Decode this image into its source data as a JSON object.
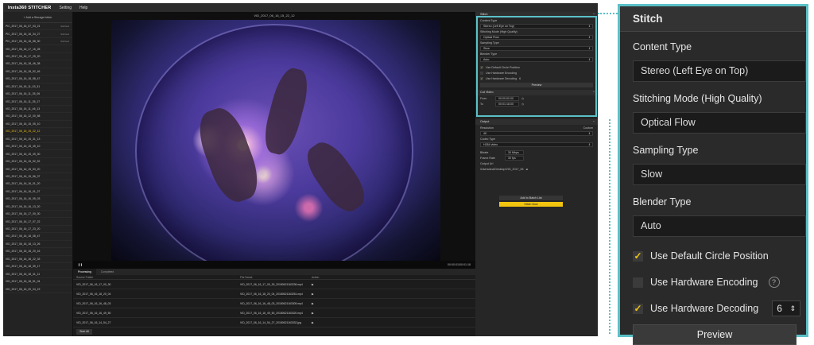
{
  "app": {
    "brand": "Insta360 STITCHER",
    "menus": [
      "Setting",
      "Help"
    ]
  },
  "sidebar": {
    "add_label": "+ Add a Storage folder",
    "files": [
      {
        "name": "PIC_2017_06_16_07_03_21",
        "status": "Stitched",
        "active": false
      },
      {
        "name": "PIC_2017_06_16_16_34_27",
        "status": "Stitched",
        "active": false
      },
      {
        "name": "PIC_2017_06_16_16_58_30",
        "status": "Stitched",
        "active": false
      },
      {
        "name": "VID_2017_06_16_17_16_28",
        "status": "",
        "active": false
      },
      {
        "name": "VID_2017_06_16_17_25_20",
        "status": "",
        "active": false
      },
      {
        "name": "VID_2017_06_16_18_46_38",
        "status": "",
        "active": false
      },
      {
        "name": "VID_2017_06_16_18_52_46",
        "status": "",
        "active": false
      },
      {
        "name": "VID_2017_06_16_18_58_47",
        "status": "",
        "active": false
      },
      {
        "name": "VID_2017_06_16_11_03_31",
        "status": "",
        "active": false
      },
      {
        "name": "VID_2017_06_16_11_35_06",
        "status": "",
        "active": false
      },
      {
        "name": "VID_2017_06_16_11_35_17",
        "status": "",
        "active": false
      },
      {
        "name": "VID_2017_06_16_11_46_13",
        "status": "",
        "active": false
      },
      {
        "name": "VID_2017_06_16_12_00_58",
        "status": "",
        "active": false
      },
      {
        "name": "VID_2017_06_16_15_05_10",
        "status": "",
        "active": false
      },
      {
        "name": "VID_2017_06_16_15_22_12",
        "status": "",
        "active": true
      },
      {
        "name": "VID_2017_06_16_15_31_13",
        "status": "",
        "active": false
      },
      {
        "name": "VID_2017_06_16_15_45_10",
        "status": "",
        "active": false
      },
      {
        "name": "VID_2017_06_16_15_49_30",
        "status": "",
        "active": false
      },
      {
        "name": "VID_2017_06_16_15_52_52",
        "status": "",
        "active": false
      },
      {
        "name": "VID_2017_06_16_15_53_20",
        "status": "",
        "active": false
      },
      {
        "name": "VID_2017_06_16_15_56_37",
        "status": "",
        "active": false
      },
      {
        "name": "VID_2017_06_16_16_01_20",
        "status": "",
        "active": false
      },
      {
        "name": "VID_2017_06_16_16_01_27",
        "status": "",
        "active": false
      },
      {
        "name": "VID_2017_06_16_16_05_03",
        "status": "",
        "active": false
      },
      {
        "name": "VID_2017_06_16_16_13_20",
        "status": "",
        "active": false
      },
      {
        "name": "VID_2017_06_16_17_00_30",
        "status": "",
        "active": false
      },
      {
        "name": "VID_2017_06_16_17_07_22",
        "status": "",
        "active": false
      },
      {
        "name": "VID_2017_06_16_17_23_20",
        "status": "",
        "active": false
      },
      {
        "name": "VID_2017_06_16_18_08_47",
        "status": "",
        "active": false
      },
      {
        "name": "VID_2017_06_16_18_13_26",
        "status": "",
        "active": false
      },
      {
        "name": "VID_2017_06_16_18_20_16",
        "status": "",
        "active": false
      },
      {
        "name": "VID_2017_06_16_18_22_33",
        "status": "",
        "active": false
      },
      {
        "name": "VID_2017_06_16_18_39_17",
        "status": "",
        "active": false
      },
      {
        "name": "VID_2017_06_16_18_41_11",
        "status": "",
        "active": false
      },
      {
        "name": "VID_2017_06_16_18_51_04",
        "status": "",
        "active": false
      },
      {
        "name": "VID_2017_06_16_20_04_19",
        "status": "",
        "active": false
      }
    ]
  },
  "viewer": {
    "title": "VID_2017_06_16_15_22_12",
    "time": "00:00:01/00:01:18"
  },
  "queue": {
    "tab_processing": "Processing",
    "tab_completed": "Completed",
    "col_source": "Source Folder",
    "col_file": "File Name",
    "col_action": "Action",
    "rows": [
      {
        "src": "VID_2017_06_16_17_00_30",
        "file": "VID_2017_06_16_17_00_30_20180621163236.mp4"
      },
      {
        "src": "VID_2017_06_16_18_20_04",
        "file": "VID_2017_06_16_18_20_04_20180621163251.mp4"
      },
      {
        "src": "VID_2017_06_16_16_48_03",
        "file": "VID_2017_06_16_16_48_03_20180621163305.mp4"
      },
      {
        "src": "VID_2017_06_16_16_49_50",
        "file": "VID_2017_06_16_16_49_50_20180621163320.mp4"
      },
      {
        "src": "VID_2017_06_16_14_54_27",
        "file": "VID_2017_06_16_14_54_27_20180621163332.jpg"
      }
    ],
    "start_all": "Start All"
  },
  "panel": {
    "stitch": "Stitch",
    "content_type_label": "Content Type",
    "content_type": "Stereo (Left Eye on Top)",
    "stitching_mode_label": "Stitching Mode  (High Quality)",
    "stitching_mode": "Optical Flow",
    "sampling_label": "Sampling Type",
    "sampling": "Slow",
    "blender_label": "Blender Type",
    "blender": "Auto",
    "cb_circle": "Use Default Circle Position",
    "cb_encoding": "Use Hardware Encoding",
    "cb_decoding": "Use Hardware Decoding",
    "decoding_count": "6",
    "preview": "Preview",
    "cut_video": "Cut Video",
    "from_label": "From",
    "from_value": "00:00:00.00",
    "to_label": "To",
    "to_value": "00:01:18.00",
    "output": "Output",
    "resolution_label": "Resolution",
    "custom_label": "Custom",
    "resolution": "4K",
    "codec_label": "Codec Type",
    "codec": "H264 video",
    "bitrate_label": "Bitrate",
    "bitrate": "30 Mbps",
    "framerate_label": "Frame Rate",
    "framerate": "30 fps",
    "output_label": "Output Url",
    "output_path": "/Users/ana/Desktop/VID_2017_06",
    "add_batch": "Add to Batch List",
    "stitch_now": "Stitch Now"
  },
  "colors": {
    "accent": "#5bc0c7",
    "active": "#f1c40f"
  }
}
